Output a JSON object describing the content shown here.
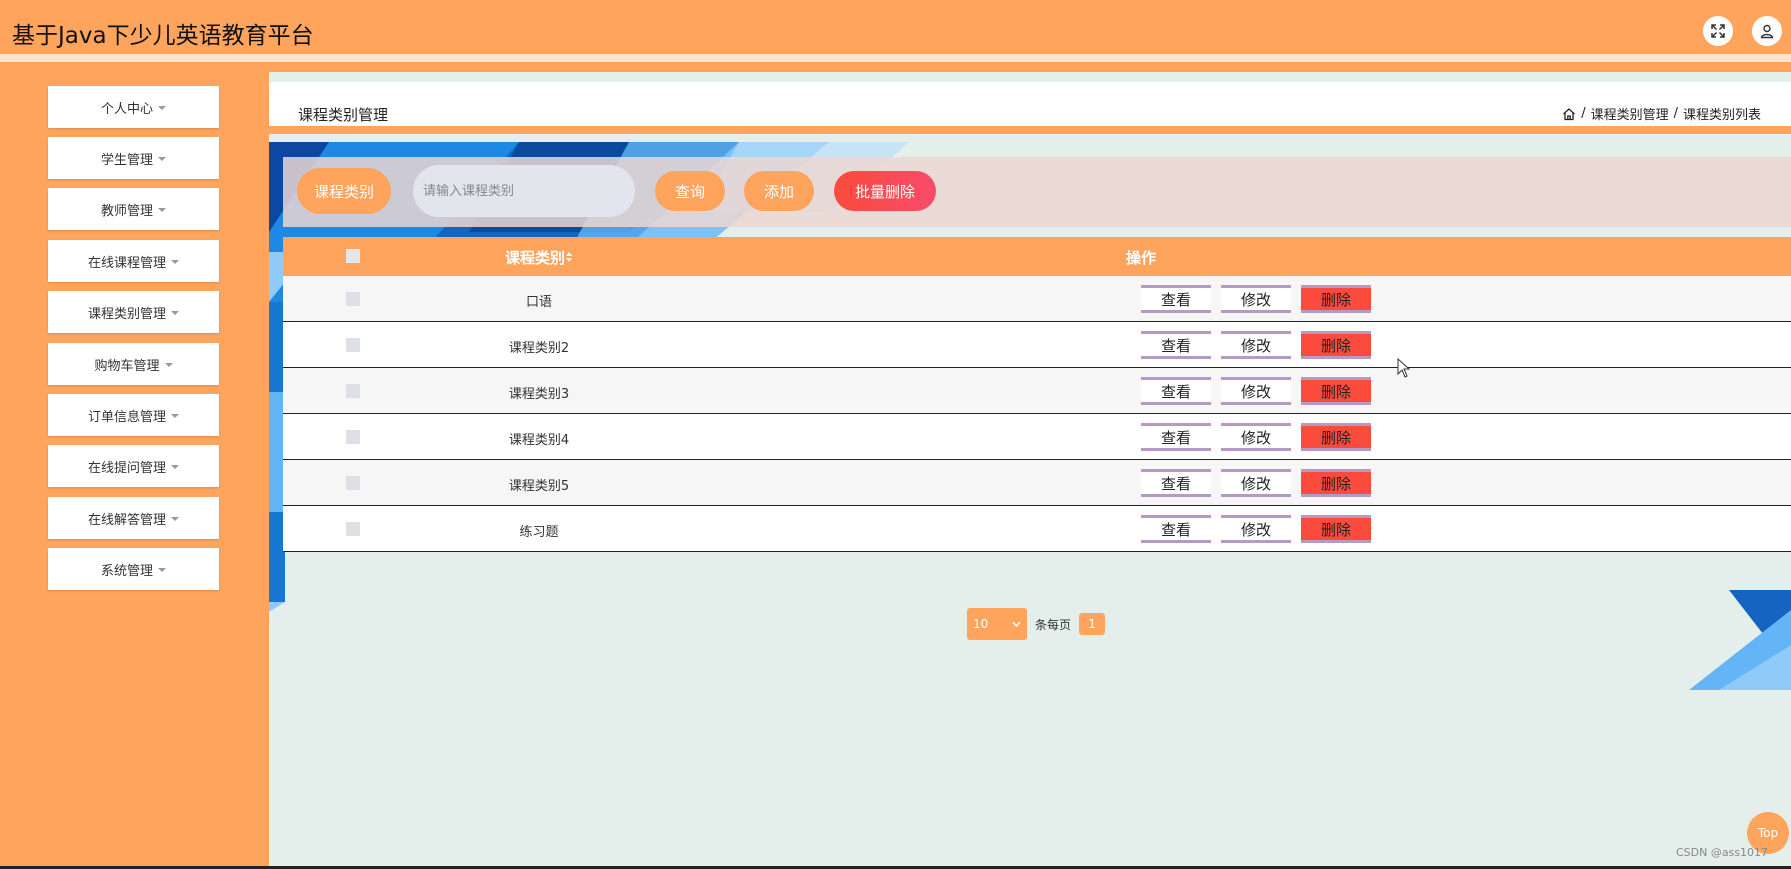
{
  "app": {
    "title": "基于Java下少儿英语教育平台"
  },
  "topbar": {
    "fullscreen_icon": "expand-icon",
    "user_icon": "user-icon"
  },
  "sidebar": {
    "items": [
      {
        "label": "个人中心"
      },
      {
        "label": "学生管理"
      },
      {
        "label": "教师管理"
      },
      {
        "label": "在线课程管理"
      },
      {
        "label": "课程类别管理"
      },
      {
        "label": "购物车管理"
      },
      {
        "label": "订单信息管理"
      },
      {
        "label": "在线提问管理"
      },
      {
        "label": "在线解答管理"
      },
      {
        "label": "系统管理"
      }
    ]
  },
  "header": {
    "title": "课程类别管理",
    "breadcrumb": {
      "home_icon": "home-icon",
      "level1": "课程类别管理",
      "level2": "课程类别列表",
      "separator": "/"
    }
  },
  "search": {
    "label": "课程类别",
    "placeholder": "请输入课程类别",
    "query_label": "查询",
    "add_label": "添加",
    "batch_delete_label": "批量删除"
  },
  "table": {
    "columns": {
      "category": "课程类别",
      "sort_icon": "sort-icon",
      "actions": "操作"
    },
    "action_labels": {
      "view": "查看",
      "edit": "修改",
      "delete": "删除"
    },
    "rows": [
      {
        "category": "口语"
      },
      {
        "category": "课程类别2"
      },
      {
        "category": "课程类别3"
      },
      {
        "category": "课程类别4"
      },
      {
        "category": "课程类别5"
      },
      {
        "category": "练习题"
      }
    ]
  },
  "pagination": {
    "page_size": "10",
    "per_page_label": "条每页",
    "current_page": "1"
  },
  "back_to_top": {
    "label": "Top"
  },
  "watermark": "CSDN @ass1017",
  "colors": {
    "primary": "#fea45d",
    "danger": "#fa4b3c",
    "background": "#e4efec"
  }
}
